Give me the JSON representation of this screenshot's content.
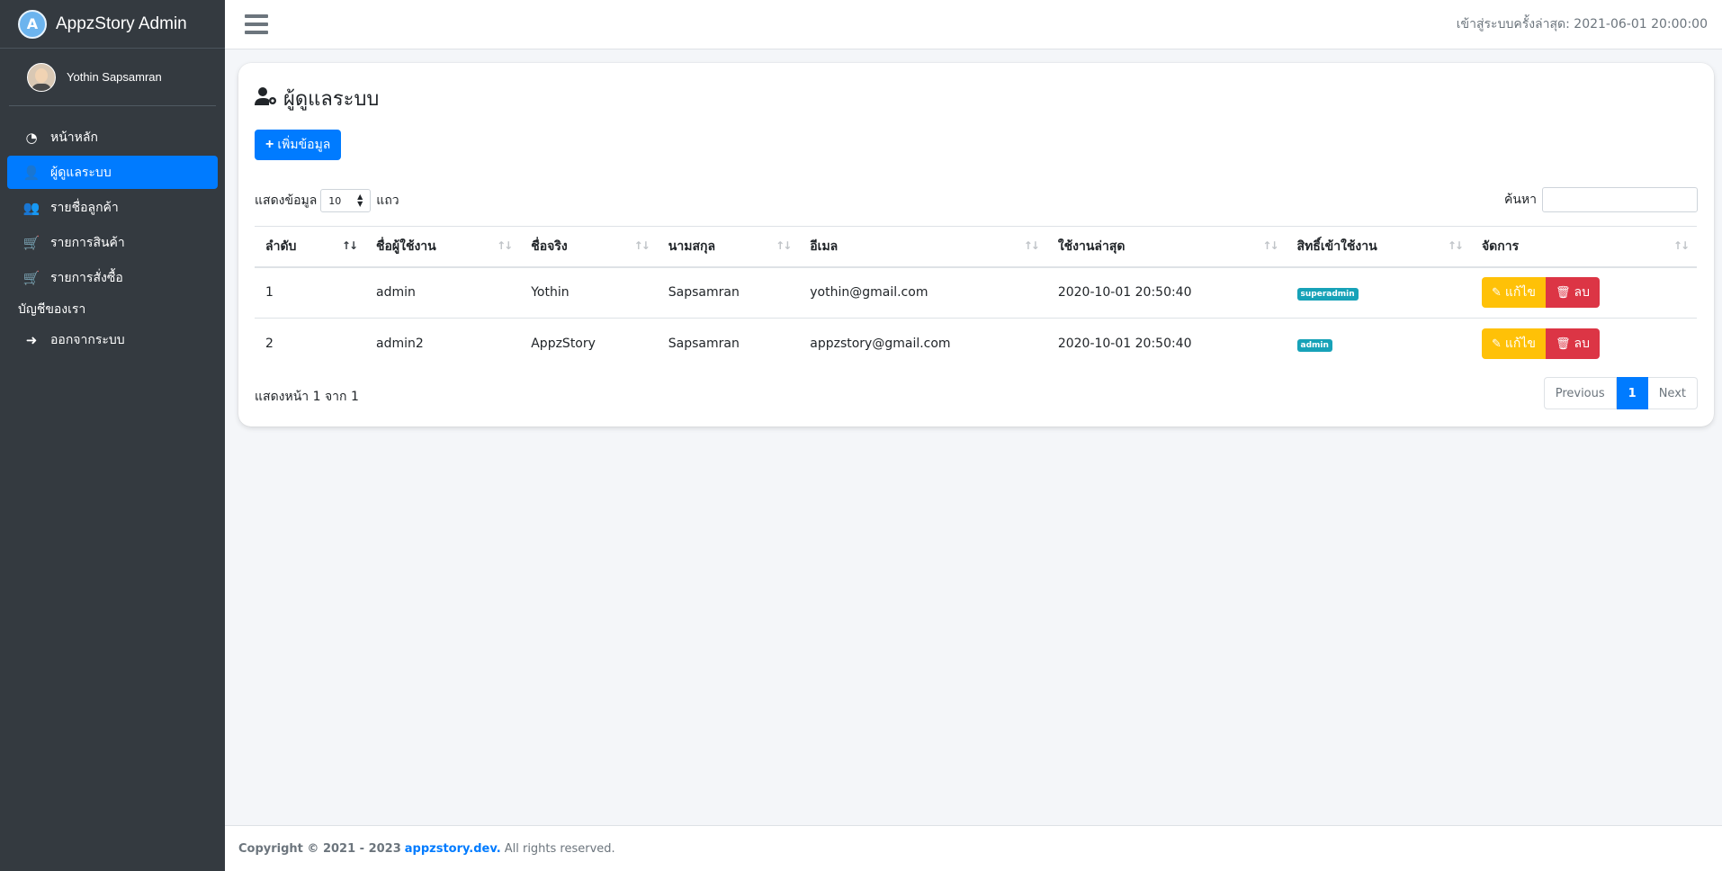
{
  "brand": {
    "logo_letter": "A",
    "name": "AppzStory Admin"
  },
  "user": {
    "name": "Yothin Sapsamran"
  },
  "sidebar": {
    "items": [
      {
        "label": "หน้าหลัก",
        "icon": "tachometer-icon",
        "glyph": "◔"
      },
      {
        "label": "ผู้ดูแลระบบ",
        "icon": "user-cog-icon",
        "glyph": "👤"
      },
      {
        "label": "รายชื่อลูกค้า",
        "icon": "users-icon",
        "glyph": "👥"
      },
      {
        "label": "รายการสินค้า",
        "icon": "shopping-cart-icon",
        "glyph": "🛒"
      },
      {
        "label": "รายการสั่งซื้อ",
        "icon": "cart-plus-icon",
        "glyph": "🛒"
      }
    ],
    "section_header": "บัญชีของเรา",
    "logout": {
      "label": "ออกจากระบบ",
      "icon": "sign-out-icon",
      "glyph": "➜"
    }
  },
  "topbar": {
    "last_login": "เข้าสู่ระบบครั้งล่าสุด: 2021-06-01 20:00:00"
  },
  "main": {
    "title": "ผู้ดูแลระบบ",
    "add_button": "เพิ่มข้อมูล",
    "length": {
      "prefix": "แสดงข้อมูล",
      "value": "10",
      "suffix": "แถว"
    },
    "search_label": "ค้นหา",
    "columns": [
      "ลำดับ",
      "ชื่อผู้ใช้งาน",
      "ชื่อจริง",
      "นามสกุล",
      "อีเมล",
      "ใช้งานล่าสุด",
      "สิทธิ์เข้าใช้งาน",
      "จัดการ"
    ],
    "rows": [
      {
        "no": "1",
        "username": "admin",
        "firstname": "Yothin",
        "lastname": "Sapsamran",
        "email": "yothin@gmail.com",
        "last_used": "2020-10-01 20:50:40",
        "role": "superadmin",
        "edit": "แก้ไข",
        "delete": "ลบ"
      },
      {
        "no": "2",
        "username": "admin2",
        "firstname": "AppzStory",
        "lastname": "Sapsamran",
        "email": "appzstory@gmail.com",
        "last_used": "2020-10-01 20:50:40",
        "role": "admin",
        "edit": "แก้ไข",
        "delete": "ลบ"
      }
    ],
    "info": "แสดงหน้า 1 จาก 1",
    "pagination": {
      "previous": "Previous",
      "current": "1",
      "next": "Next"
    }
  },
  "footer": {
    "copyright": "Copyright © 2021 - 2023",
    "link": "appzstory.dev.",
    "rights": "All rights reserved."
  },
  "colors": {
    "primary": "#007bff",
    "sidebar": "#343a40",
    "warning": "#ffc107",
    "danger": "#dc3545",
    "info": "#17a2b8"
  }
}
